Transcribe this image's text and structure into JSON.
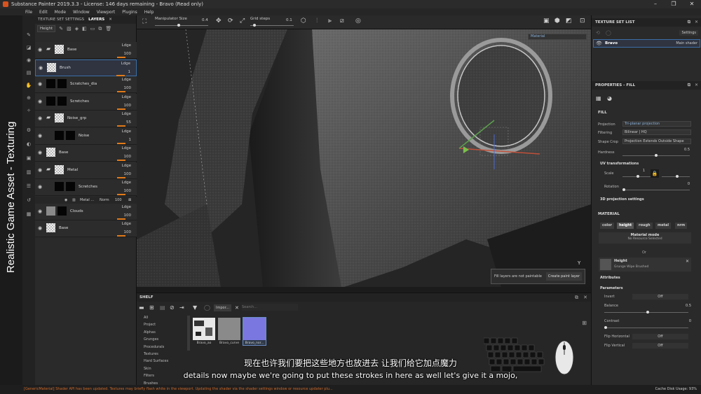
{
  "window": {
    "title": "Substance Painter 2019.3.3 - License: 146 days remaining - Bravo (Read only)",
    "controls": [
      "–",
      "❐",
      "✕"
    ]
  },
  "menu": [
    "File",
    "Edit",
    "Mode",
    "Window",
    "Viewport",
    "Plugins",
    "Help"
  ],
  "overlay_title": "Realistic Game Asset - Texturing",
  "layers_panel": {
    "tabs": [
      "TEXTURE SET SETTINGS",
      "LAYERS"
    ],
    "channel": "Height",
    "layers": [
      {
        "name": "Base",
        "blend": "Ldge",
        "opacity": "100",
        "thumb": "checker",
        "folder": true
      },
      {
        "name": "Brush",
        "blend": "Ldge",
        "opacity": "1",
        "thumb": "checker",
        "folder": false,
        "selected": true
      },
      {
        "name": "Scratches_dia",
        "blend": "Ldge",
        "opacity": "100",
        "thumb": "black",
        "folder": false
      },
      {
        "name": "Scretches",
        "blend": "Ldge",
        "opacity": "100",
        "thumb": "black",
        "folder": false
      },
      {
        "name": "Noise_grp",
        "blend": "Ldge",
        "opacity": "55",
        "thumb": "checker",
        "folder": true
      },
      {
        "name": "Noise",
        "blend": "Ldge",
        "opacity": "1",
        "thumb": "black",
        "folder": false
      },
      {
        "name": "Base",
        "blend": "Ldge",
        "opacity": "100",
        "thumb": "checker",
        "folder": false
      },
      {
        "name": "Metal",
        "blend": "Ldge",
        "opacity": "100",
        "thumb": "checker",
        "folder": true
      },
      {
        "name": "Scretches",
        "blend": "Ldge",
        "opacity": "100",
        "thumb": "black",
        "folder": false
      },
      {
        "name": "Clouds",
        "blend": "Ldge",
        "opacity": "100",
        "thumb": "grey",
        "folder": false
      },
      {
        "name": "Base",
        "blend": "Ldge",
        "opacity": "100",
        "thumb": "checker",
        "folder": false
      }
    ],
    "metal_sub": {
      "label": "Metal ...",
      "blend": "Norm",
      "opacity": "100"
    }
  },
  "viewport": {
    "manipulator_label": "Manipulator Size",
    "manipulator_value": "0.4",
    "grid_label": "Grid steps",
    "grid_value": "0.1",
    "material_dropdown": "Material",
    "fill_notice": "Fill layers are not paintable",
    "create_paint_layer": "Create paint layer",
    "axis_label": "Y"
  },
  "shelf": {
    "title": "SHELF",
    "filter_tag": "Impor...",
    "search_placeholder": "Search...",
    "categories": [
      "All",
      "Project",
      "Alphas",
      "Grunges",
      "Procedurals",
      "Textures",
      "Hard Surfaces",
      "Skin",
      "Filters",
      "Brushes"
    ],
    "items": [
      "Bravo_ao",
      "Bravo_curve",
      "Bravo_nor..."
    ]
  },
  "texture_set_list": {
    "title": "TEXTURE SET LIST",
    "settings_label": "Settings",
    "item_name": "Bravo",
    "shader": "Main shader"
  },
  "properties": {
    "title": "PROPERTIES - FILL",
    "section_fill": "FILL",
    "projection_label": "Projection",
    "projection_value": "Tri-planar projection",
    "filtering_label": "Filtering",
    "filtering_value": "Bilinear | HQ",
    "shape_crop_label": "Shape Crop",
    "shape_crop_value": "Projection Extends Outside Shape",
    "hardness_label": "Hardness",
    "hardness_value": "0.5",
    "uv_label": "UV transformations",
    "scale_label": "Scale",
    "scale_value": "1",
    "rotation_label": "Rotation",
    "rotation_value": "0",
    "proj3d_label": "3D projection settings",
    "section_material": "MATERIAL",
    "channels": [
      "color",
      "height",
      "rough",
      "metal",
      "nrm"
    ],
    "material_mode_label": "Material mode",
    "material_mode_value": "No Resource Selected",
    "or_label": "Or",
    "height_label": "Height",
    "height_resource": "Grunge Wipe Brushed",
    "attributes_label": "Attributes",
    "parameters_label": "Parameters",
    "invert_label": "Invert",
    "invert_value": "Off",
    "balance_label": "Balance",
    "balance_value": "0.5",
    "contrast_label": "Contrast",
    "contrast_value": "0",
    "flip_h_label": "Flip Horizontal",
    "flip_h_value": "Off",
    "flip_v_label": "Flip Vertical",
    "flip_v_value": "Off"
  },
  "status": {
    "message": "[GenericMaterial] Shader API has been updated. Textures may briefly flash white in the viewport. Updating the shader via the shader settings window or resource updater plu...",
    "cache": "Cache Disk Usage:   93%"
  },
  "subtitles": {
    "cn": "现在也许我们要把这些地方也放进去 让我们给它加点魔力",
    "en": "details now maybe we're going to put these strokes in here as well let's give it a mojo,"
  }
}
